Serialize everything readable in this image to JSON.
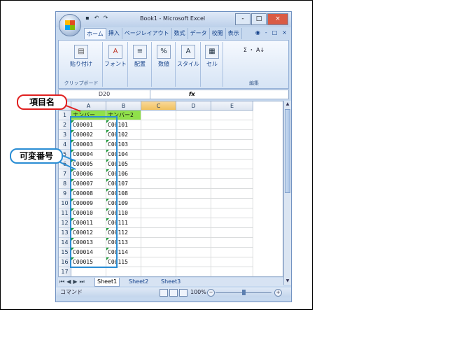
{
  "window": {
    "title": "Book1 - Microsoft Excel",
    "controls": [
      "-",
      "□",
      "×"
    ]
  },
  "ribbon_tabs": [
    "ホーム",
    "挿入",
    "ページレイアウト",
    "数式",
    "データ",
    "校閲",
    "表示"
  ],
  "mdi_controls": [
    "-",
    "□",
    "×"
  ],
  "ribbon_groups": [
    {
      "label": "貼り付け",
      "caption": "クリップボード"
    },
    {
      "label": "フォント"
    },
    {
      "label": "配置"
    },
    {
      "label": "数値"
    },
    {
      "label": "スタイル"
    },
    {
      "label": "セル"
    },
    {
      "label": "Σ ・ A↓",
      "caption": "編集"
    }
  ],
  "formula_bar": {
    "name_box": "D20",
    "fx": "fx"
  },
  "columns": [
    "A",
    "B",
    "C",
    "D",
    "E"
  ],
  "rows": [
    {
      "n": "1",
      "a": "ナンバー",
      "b": "ナンバー2"
    },
    {
      "n": "2",
      "a": "C00001",
      "b": "C00101"
    },
    {
      "n": "3",
      "a": "C00002",
      "b": "C00102"
    },
    {
      "n": "4",
      "a": "C00003",
      "b": "C00103"
    },
    {
      "n": "5",
      "a": "C00004",
      "b": "C00104"
    },
    {
      "n": "6",
      "a": "C00005",
      "b": "C00105"
    },
    {
      "n": "7",
      "a": "C00006",
      "b": "C00106"
    },
    {
      "n": "8",
      "a": "C00007",
      "b": "C00107"
    },
    {
      "n": "9",
      "a": "C00008",
      "b": "C00108"
    },
    {
      "n": "10",
      "a": "C00009",
      "b": "C00109"
    },
    {
      "n": "11",
      "a": "C00010",
      "b": "C00110"
    },
    {
      "n": "12",
      "a": "C00011",
      "b": "C00111"
    },
    {
      "n": "13",
      "a": "C00012",
      "b": "C00112"
    },
    {
      "n": "14",
      "a": "C00013",
      "b": "C00113"
    },
    {
      "n": "15",
      "a": "C00014",
      "b": "C00114"
    },
    {
      "n": "16",
      "a": "C00015",
      "b": "C00115"
    },
    {
      "n": "17",
      "a": "",
      "b": ""
    }
  ],
  "sheet_tabs": [
    "Sheet1",
    "Sheet2",
    "Sheet3"
  ],
  "status": {
    "mode": "コマンド",
    "zoom": "100%"
  },
  "callouts": {
    "item_name": "項目名",
    "variable_number": "可変番号"
  },
  "colors": {
    "header_fill": "#8fe04a",
    "callout_red": "#e02020",
    "callout_blue": "#2a8dd4"
  }
}
